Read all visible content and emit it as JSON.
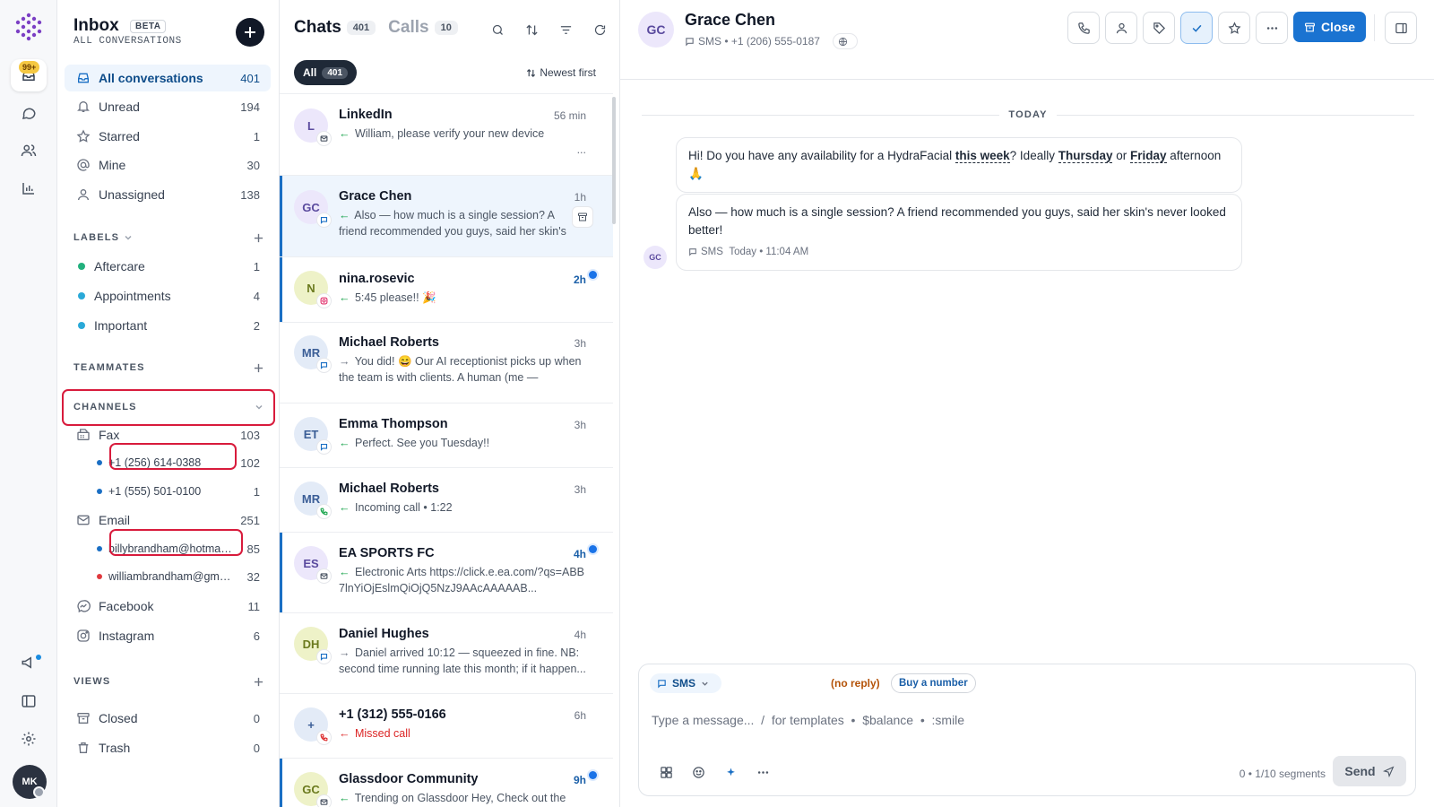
{
  "rail": {
    "badge": "99+",
    "avatar_initials": "MK"
  },
  "sidebar": {
    "title": "Inbox",
    "beta": "BETA",
    "subtitle": "ALL CONVERSATIONS",
    "main_items": [
      {
        "label": "All conversations",
        "count": "401",
        "icon": "inbox-icon"
      },
      {
        "label": "Unread",
        "count": "194",
        "icon": "bell-icon"
      },
      {
        "label": "Starred",
        "count": "1",
        "icon": "star-icon"
      },
      {
        "label": "Mine",
        "count": "30",
        "icon": "at-icon"
      },
      {
        "label": "Unassigned",
        "count": "138",
        "icon": "user-icon"
      }
    ],
    "labels_header": "LABELS",
    "labels": [
      {
        "label": "Aftercare",
        "count": "1",
        "color": "#22b07d"
      },
      {
        "label": "Appointments",
        "count": "4",
        "color": "#2aa9d8"
      },
      {
        "label": "Important",
        "count": "2",
        "color": "#2aa9d8"
      }
    ],
    "teammates_header": "TEAMMATES",
    "channels_header": "CHANNELS",
    "channels": {
      "fax": {
        "label": "Fax",
        "count": "103"
      },
      "fax_numbers": [
        {
          "label": "+1 (256) 614-0388",
          "count": "102",
          "color": "#1a6fc4"
        },
        {
          "label": "+1 (555) 501-0100",
          "count": "1",
          "color": "#1a6fc4"
        }
      ],
      "email": {
        "label": "Email",
        "count": "251"
      },
      "email_accounts": [
        {
          "label": "billybrandham@hotmail...",
          "count": "85",
          "color": "#1a6fc4"
        },
        {
          "label": "williambrandham@gma...",
          "count": "32",
          "color": "#e0393e"
        }
      ],
      "facebook": {
        "label": "Facebook",
        "count": "11"
      },
      "instagram": {
        "label": "Instagram",
        "count": "6"
      }
    },
    "views_header": "VIEWS",
    "views": [
      {
        "label": "Closed",
        "count": "0"
      },
      {
        "label": "Trash",
        "count": "0"
      }
    ]
  },
  "chatlist": {
    "tab_chats": "Chats",
    "tab_chats_count": "401",
    "tab_calls": "Calls",
    "tab_calls_count": "10",
    "filter_all": "All",
    "filter_all_count": "401",
    "sort_label": "Newest first",
    "items": [
      {
        "initials": "L",
        "name": "LinkedIn",
        "time": "56 min",
        "preview": "William, please verify your new device",
        "extra": "...",
        "channel": "email"
      },
      {
        "initials": "GC",
        "name": "Grace Chen",
        "time": "1h",
        "preview": "Also — how much is a single session? A friend recommended you guys, said her skin's never...",
        "channel": "sms"
      },
      {
        "initials": "N",
        "name": "nina.rosevic",
        "time": "2h",
        "preview": "5:45 please!! 🎉",
        "channel": "instagram"
      },
      {
        "initials": "MR",
        "name": "Michael Roberts",
        "time": "3h",
        "preview": "You did! 😄 Our AI receptionist picks up when the team is with clients. A human (me — Sarah!)...",
        "channel": "sms"
      },
      {
        "initials": "ET",
        "name": "Emma Thompson",
        "time": "3h",
        "preview": "Perfect. See you Tuesday!!",
        "channel": "sms"
      },
      {
        "initials": "MR",
        "name": "Michael Roberts",
        "time": "3h",
        "preview": "Incoming call • 1:22",
        "channel": "phone"
      },
      {
        "initials": "ES",
        "name": "EA SPORTS FC",
        "time": "4h",
        "preview": "Electronic Arts https://click.e.ea.com/?qs=ABB7lnYiOjEslmQiOjQ5NzJ9AAcAAAAAB...",
        "channel": "email"
      },
      {
        "initials": "DH",
        "name": "Daniel Hughes",
        "time": "4h",
        "preview": "Daniel arrived 10:12 — squeezed in fine. NB: second time running late this month; if it happen...",
        "channel": "sms"
      },
      {
        "initials": "+",
        "name": "+1 (312) 555-0166",
        "time": "6h",
        "preview": "Missed call",
        "channel": "phone-missed"
      },
      {
        "initials": "GC",
        "name": "Glassdoor Community",
        "time": "9h",
        "preview": "Trending on Glassdoor Hey, Check out the",
        "channel": "email"
      }
    ]
  },
  "conversation": {
    "avatar_initials": "GC",
    "name": "Grace Chen",
    "meta": "SMS • +1 (206) 555-0187",
    "close_label": "Close",
    "day_label": "TODAY",
    "messages": [
      {
        "parts": [
          "Hi! Do you have any availability for a HydraFacial ",
          "this week",
          "? Ideally ",
          "Thursday",
          " or ",
          "Friday",
          " afternoon 🙏"
        ]
      },
      {
        "text": "Also — how much is a single session? A friend recommended you guys, said her skin's never looked better!",
        "channel": "SMS",
        "time": "Today • 11:04 AM"
      }
    ],
    "msg_avatar_initials": "GC",
    "composer": {
      "channel": "SMS",
      "no_reply": "(no reply)",
      "buy_number": "Buy a number",
      "placeholder": "Type a message...  /  for templates  •  $balance  •  :smile",
      "segments": "0 • 1/10 segments",
      "send_label": "Send"
    }
  }
}
